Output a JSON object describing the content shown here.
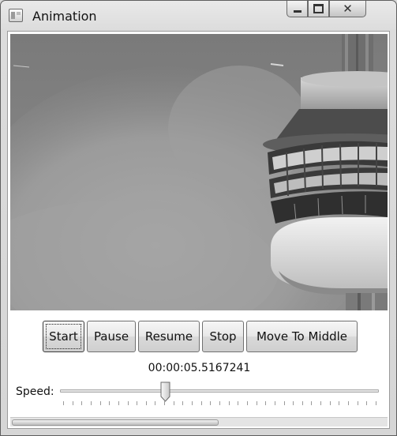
{
  "window": {
    "title": "Animation"
  },
  "media": {
    "icon": "image-icon"
  },
  "controls": {
    "start_label": "Start",
    "pause_label": "Pause",
    "resume_label": "Resume",
    "stop_label": "Stop",
    "move_to_middle_label": "Move To Middle",
    "focused": "Start"
  },
  "status": {
    "timecode": "00:00:05.5167241"
  },
  "speed": {
    "label": "Speed:",
    "slider_value_fraction": 0.33,
    "tick_count": 35
  },
  "colors": {
    "window_frame": "#d9d9d9",
    "client_background": "#ffffff",
    "button_border": "#707070"
  }
}
